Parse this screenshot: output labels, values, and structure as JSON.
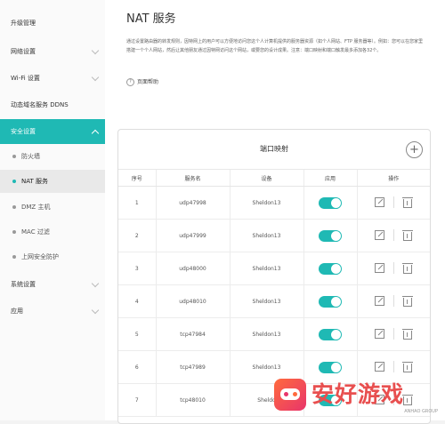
{
  "sidebar": {
    "items": [
      {
        "label": "升级管理"
      },
      {
        "label": "网络设置"
      },
      {
        "label": "Wi-Fi 设置"
      },
      {
        "label": "动态域名服务 DDNS"
      },
      {
        "label": "安全设置"
      },
      {
        "label": "系统设置"
      },
      {
        "label": "应用"
      }
    ],
    "sub_items": [
      {
        "label": "防火墙"
      },
      {
        "label": "NAT 服务"
      },
      {
        "label": "DMZ 主机"
      },
      {
        "label": "MAC 过滤"
      },
      {
        "label": "上网安全防护"
      }
    ]
  },
  "page": {
    "title": "NAT 服务",
    "description": "通过设置路由器的转发规则，因特网上的用户可以方便地访问您这个人计算机提供的服务器资源（如个人网站、FTP 服务器等）。例如：您可以在您家里搭建一个个人网站，然后让其他朋友通过因特网访问这个网站，或要您的设计成果。注意：端口映射和端口触发最多添加各32个。",
    "help_label": "页面帮助"
  },
  "panel": {
    "title": "端口映射",
    "add_symbol": "+"
  },
  "table": {
    "headers": [
      "序号",
      "服务名",
      "设备",
      "应用",
      "操作"
    ],
    "rows": [
      {
        "index": "1",
        "service": "udp47998",
        "device": "Sheldon13",
        "enabled": true
      },
      {
        "index": "2",
        "service": "udp47999",
        "device": "Sheldon13",
        "enabled": true
      },
      {
        "index": "3",
        "service": "udp48000",
        "device": "Sheldon13",
        "enabled": true
      },
      {
        "index": "4",
        "service": "udp48010",
        "device": "Sheldon13",
        "enabled": true
      },
      {
        "index": "5",
        "service": "tcp47984",
        "device": "Sheldon13",
        "enabled": true
      },
      {
        "index": "6",
        "service": "tcp47989",
        "device": "Sheldon13",
        "enabled": true
      },
      {
        "index": "7",
        "service": "tcp48010",
        "device": "Sheldo",
        "enabled": true
      }
    ]
  },
  "watermark": {
    "text": "安好游戏",
    "sub": "ANHAO GROUP"
  },
  "colors": {
    "accent": "#1fb9b4",
    "watermark": "#e84f4f"
  },
  "icons": {
    "edit": "edit-icon",
    "delete": "trash-icon",
    "help": "help-icon",
    "add": "add-icon"
  }
}
